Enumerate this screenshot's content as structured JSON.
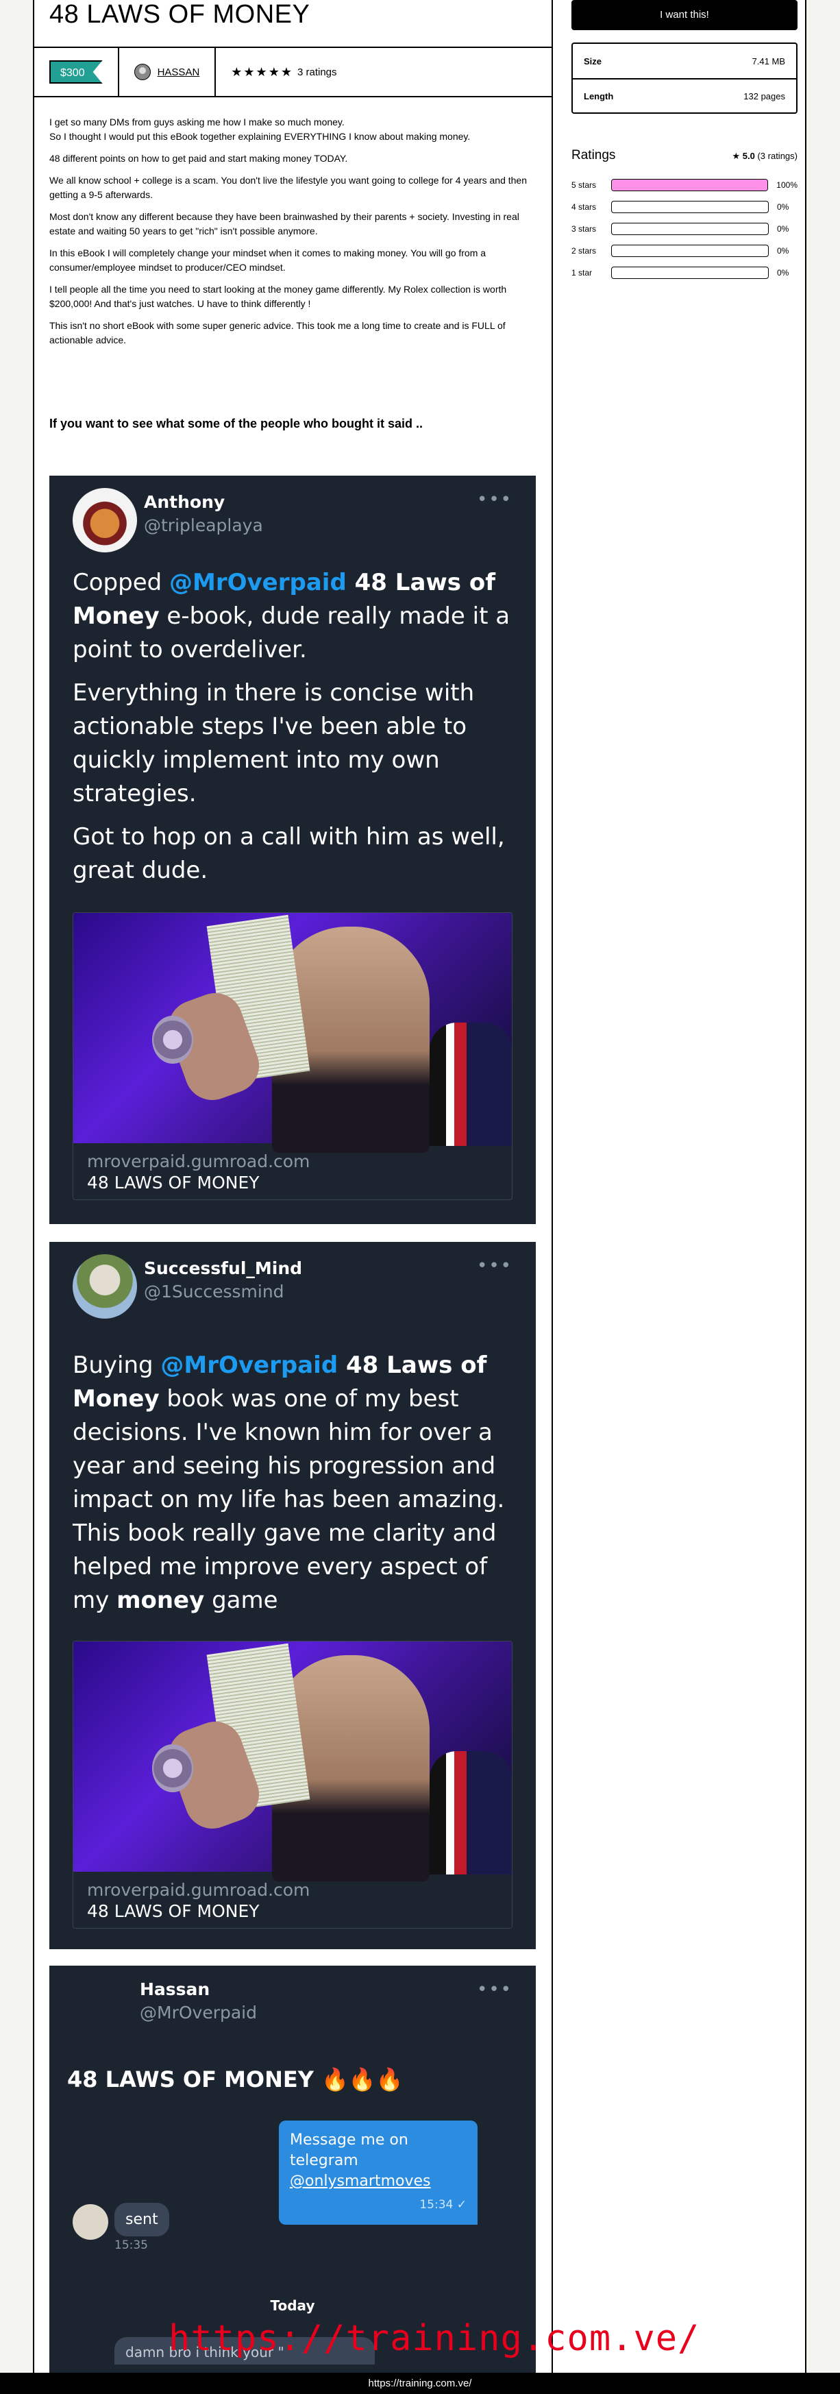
{
  "product": {
    "title": "48 LAWS OF MONEY",
    "price": "$300",
    "author": "HASSAN",
    "stars": "★★★★★",
    "ratings_count": "3 ratings"
  },
  "description": [
    "I get so many DMs from guys asking me how I make so much money.",
    "So I thought I would put this eBook together explaining EVERYTHING I know about making money.",
    "48 different points on how to get paid and start making money TODAY.",
    "We all know school + college is a scam. You don't live the lifestyle you want going to college for 4 years and then getting a 9-5 afterwards.",
    "Most don't know any different because they have been brainwashed by their parents + society. Investing in real estate and waiting 50 years to get \"rich\" isn't possible anymore.",
    "In this eBook I will completely change your mindset when it comes to making money. You will go from a consumer/employee mindset to producer/CEO mindset.",
    "I tell people all the time you need to start looking at the money game differently. My Rolex collection is worth $200,000! And that's just watches. U have to think differently !",
    "This isn't no short eBook with some super generic advice. This took me a long time to create and is FULL of actionable advice."
  ],
  "lead_text": "If you want to see what some of the people who bought it said ..",
  "tweets": [
    {
      "name": "Anthony",
      "handle": "@tripleaplaya",
      "p1_pre": "Copped ",
      "p1_mention": "@MrOverpaid",
      "p1_bold": " 48 Laws of Money",
      "p1_post": " e-book, dude really made it a point to overdeliver.",
      "p2": "Everything in there is concise with actionable steps I've been able to quickly implement into my own strategies.",
      "p3": "Got to hop on a call with him as well, great dude.",
      "card_domain": "mroverpaid.gumroad.com",
      "card_title": "48 LAWS OF MONEY"
    },
    {
      "name": "Successful_Mind",
      "handle": "@1Successmind",
      "p1_pre": "Buying ",
      "p1_mention": "@MrOverpaid",
      "p1_bold": " 48 Laws of Money",
      "p1_post": " book was one of my best decisions. I've known him for over a year and seeing his progression and impact on my life has been amazing. This book really gave me clarity and helped me improve every aspect of my ",
      "p1_bold2": "money",
      "p1_end": " game",
      "card_domain": "mroverpaid.gumroad.com",
      "card_title": "48 LAWS OF MONEY"
    },
    {
      "name": "Hassan",
      "handle": "@MrOverpaid",
      "headline": "48 LAWS OF MONEY 🔥🔥🔥",
      "msg_out": "Message me on telegram",
      "msg_out_link": "@onlysmartmoves",
      "msg_out_time": "15:34 ✓",
      "msg_in": "sent",
      "msg_in_time": "15:35",
      "day": "Today",
      "msg_last": "damn bro i think your \""
    }
  ],
  "sidebar": {
    "buy_label": "I want this!",
    "size_label": "Size",
    "size_value": "7.41 MB",
    "length_label": "Length",
    "length_value": "132 pages",
    "ratings_title": "Ratings",
    "ratings_summary_score": "5.0",
    "ratings_summary_count": "(3 ratings)",
    "breakdown": [
      {
        "label": "5 stars",
        "pct": "100%",
        "fraction": 1.0
      },
      {
        "label": "4 stars",
        "pct": "0%",
        "fraction": 0
      },
      {
        "label": "3 stars",
        "pct": "0%",
        "fraction": 0
      },
      {
        "label": "2 stars",
        "pct": "0%",
        "fraction": 0
      },
      {
        "label": "1 star",
        "pct": "0%",
        "fraction": 0
      }
    ]
  },
  "watermark": "https://training.com.ve/",
  "footer_url": "https://training.com.ve/",
  "colors": {
    "accent_pink": "#ff90e8",
    "price_teal": "#23a094",
    "mention_blue": "#1d9bf0",
    "tweet_bg": "#1c2430"
  }
}
